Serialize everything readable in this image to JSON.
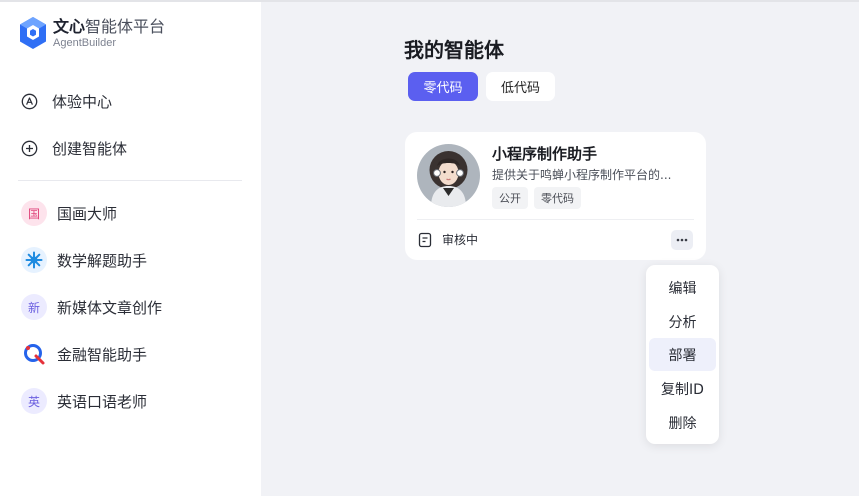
{
  "brand": {
    "title_bold": "文心",
    "title_light": "智能体平台",
    "subtitle": "AgentBuilder"
  },
  "nav": [
    {
      "label": "体验中心",
      "icon": "compass-icon"
    },
    {
      "label": "创建智能体",
      "icon": "plus-circle-icon"
    }
  ],
  "agents": [
    {
      "label": "国画大师",
      "avatar_text": "国",
      "avatar_bg": "#fde3ec",
      "avatar_color": "#e0457b"
    },
    {
      "label": "数学解题助手",
      "avatar_text": "",
      "icon": "sparkle-icon",
      "avatar_bg": "#e6f2ff",
      "avatar_color": "#1e8be0"
    },
    {
      "label": "新媒体文章创作",
      "avatar_text": "新",
      "avatar_bg": "#ecebff",
      "avatar_color": "#6b5fe0"
    },
    {
      "label": "金融智能助手",
      "avatar_text": "",
      "icon": "finance-q-icon",
      "avatar_bg": "#ffffff",
      "avatar_color": "#2563eb"
    },
    {
      "label": "英语口语老师",
      "avatar_text": "英",
      "avatar_bg": "#ecebff",
      "avatar_color": "#6b5fe0"
    }
  ],
  "main": {
    "title": "我的智能体",
    "tabs": [
      {
        "label": "零代码",
        "active": true
      },
      {
        "label": "低代码",
        "active": false
      }
    ]
  },
  "card": {
    "name": "小程序制作助手",
    "description": "提供关于鸣蝉小程序制作平台的...",
    "tags": [
      "公开",
      "零代码"
    ],
    "status": "审核中"
  },
  "menu": [
    {
      "label": "编辑"
    },
    {
      "label": "分析"
    },
    {
      "label": "部署",
      "hover": true
    },
    {
      "label": "复制ID"
    },
    {
      "label": "删除"
    }
  ],
  "colors": {
    "accent": "#5b5ff0",
    "background": "#f1f2f6"
  }
}
